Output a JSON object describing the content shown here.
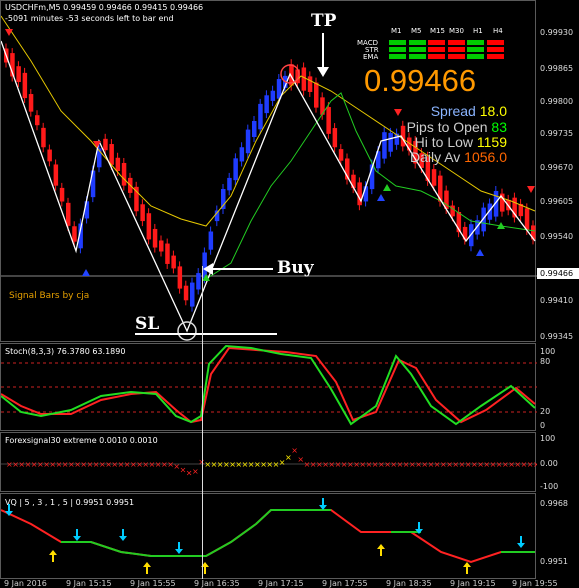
{
  "header": {
    "symbol_info": "USDCHFm,M5  0.99459 0.99466 0.99415 0.99466",
    "timer": "-5091 minutes -53 seconds left to bar end"
  },
  "price_axis": [
    "0.99930",
    "0.99865",
    "0.99800",
    "0.99735",
    "0.99670",
    "0.99605",
    "0.99540",
    "0.99466",
    "0.99410",
    "0.99345"
  ],
  "current_price_label": "0.99466",
  "annotations": {
    "tp": "TP",
    "sl": "SL",
    "buy": "Buy"
  },
  "signal_bars": {
    "label": "Signal Bars by cja",
    "timeframes": [
      "M1",
      "M5",
      "M15",
      "M30",
      "H1",
      "H4"
    ],
    "rows": [
      "MACD",
      "STR",
      "EMA"
    ],
    "grid_colors": [
      [
        "#00cc00",
        "#00cc00",
        "#ff0000",
        "#ff0000",
        "#00cc00",
        "#ff0000"
      ],
      [
        "#00cc00",
        "#00cc00",
        "#ff0000",
        "#ff0000",
        "#00cc00",
        "#ff0000"
      ],
      [
        "#00cc00",
        "#00cc00",
        "#ff0000",
        "#ff0000",
        "#00cc00",
        "#ff0000"
      ]
    ],
    "big_price": "0.99466",
    "spread_label": "Spread",
    "spread_value": "18.0",
    "pips_label": "Pips to Open",
    "pips_value": "83",
    "hilo_label": "Hi to Low",
    "hilo_value": "1159",
    "daily_label": "Daily Av",
    "daily_value": "1056.0"
  },
  "stoch": {
    "title": "Stoch(8,3,3) 76.3780 63.1890",
    "axis": [
      "100",
      "80",
      "20",
      "0"
    ]
  },
  "forex": {
    "title": "Forexsignal30 extreme 0.0010 0.0010",
    "axis": [
      "100",
      "0.00",
      "-100"
    ]
  },
  "vq": {
    "title": "VQ | 5 , 3 , 1 , 5  | 0.9951 0.9951",
    "axis": [
      "0.9968",
      "0.9951"
    ]
  },
  "time_axis": [
    "9 Jan 2016",
    "9 Jan 15:15",
    "9 Jan 15:55",
    "9 Jan 16:35",
    "9 Jan 17:15",
    "9 Jan 17:55",
    "9 Jan 18:35",
    "9 Jan 19:15",
    "9 Jan 19:55"
  ],
  "colors": {
    "bull": "#1f3cff",
    "bear": "#ff1a1a",
    "ma_yellow": "#e6c800",
    "ma_green": "#22cc22",
    "zigzag": "#ffffff",
    "big_price": "#ff9900",
    "spread_value": "#ffff00",
    "pips_value": "#00ff00",
    "hilo_value": "#ffff00",
    "daily_value": "#ff6600"
  }
}
